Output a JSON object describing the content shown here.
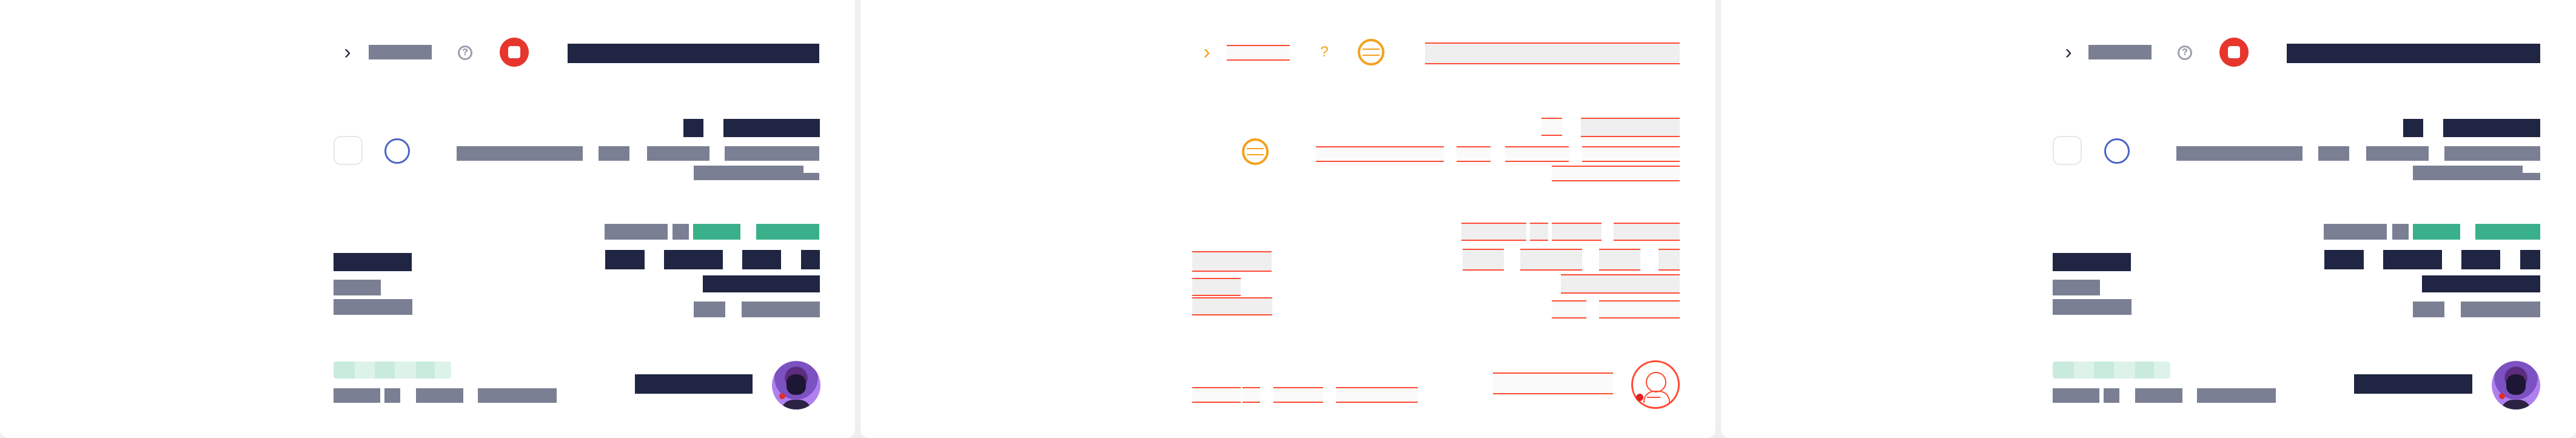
{
  "panels": {
    "left": {
      "accent": "#e32a26",
      "avatar_status_text": "",
      "avatar_status_color": "#d9534f"
    },
    "middle": {
      "accent": "#ff4b33",
      "avatar_status_text": ""
    },
    "right": {
      "accent": "#7b8cf2",
      "avatar_status_text": ""
    }
  },
  "icons": {
    "chevron": "chevron-right-icon",
    "help": "help-circle-icon",
    "stop": "stop-icon",
    "checkbox": "checkbox-icon",
    "radio": "radio-icon",
    "avatar": "avatar"
  },
  "colors": {
    "navy": "#1f2542",
    "gray": "#7b7f93",
    "green": "#3ab08a",
    "red": "#e6362e",
    "blue": "#4e64c5",
    "orange": "#f3a11d"
  }
}
